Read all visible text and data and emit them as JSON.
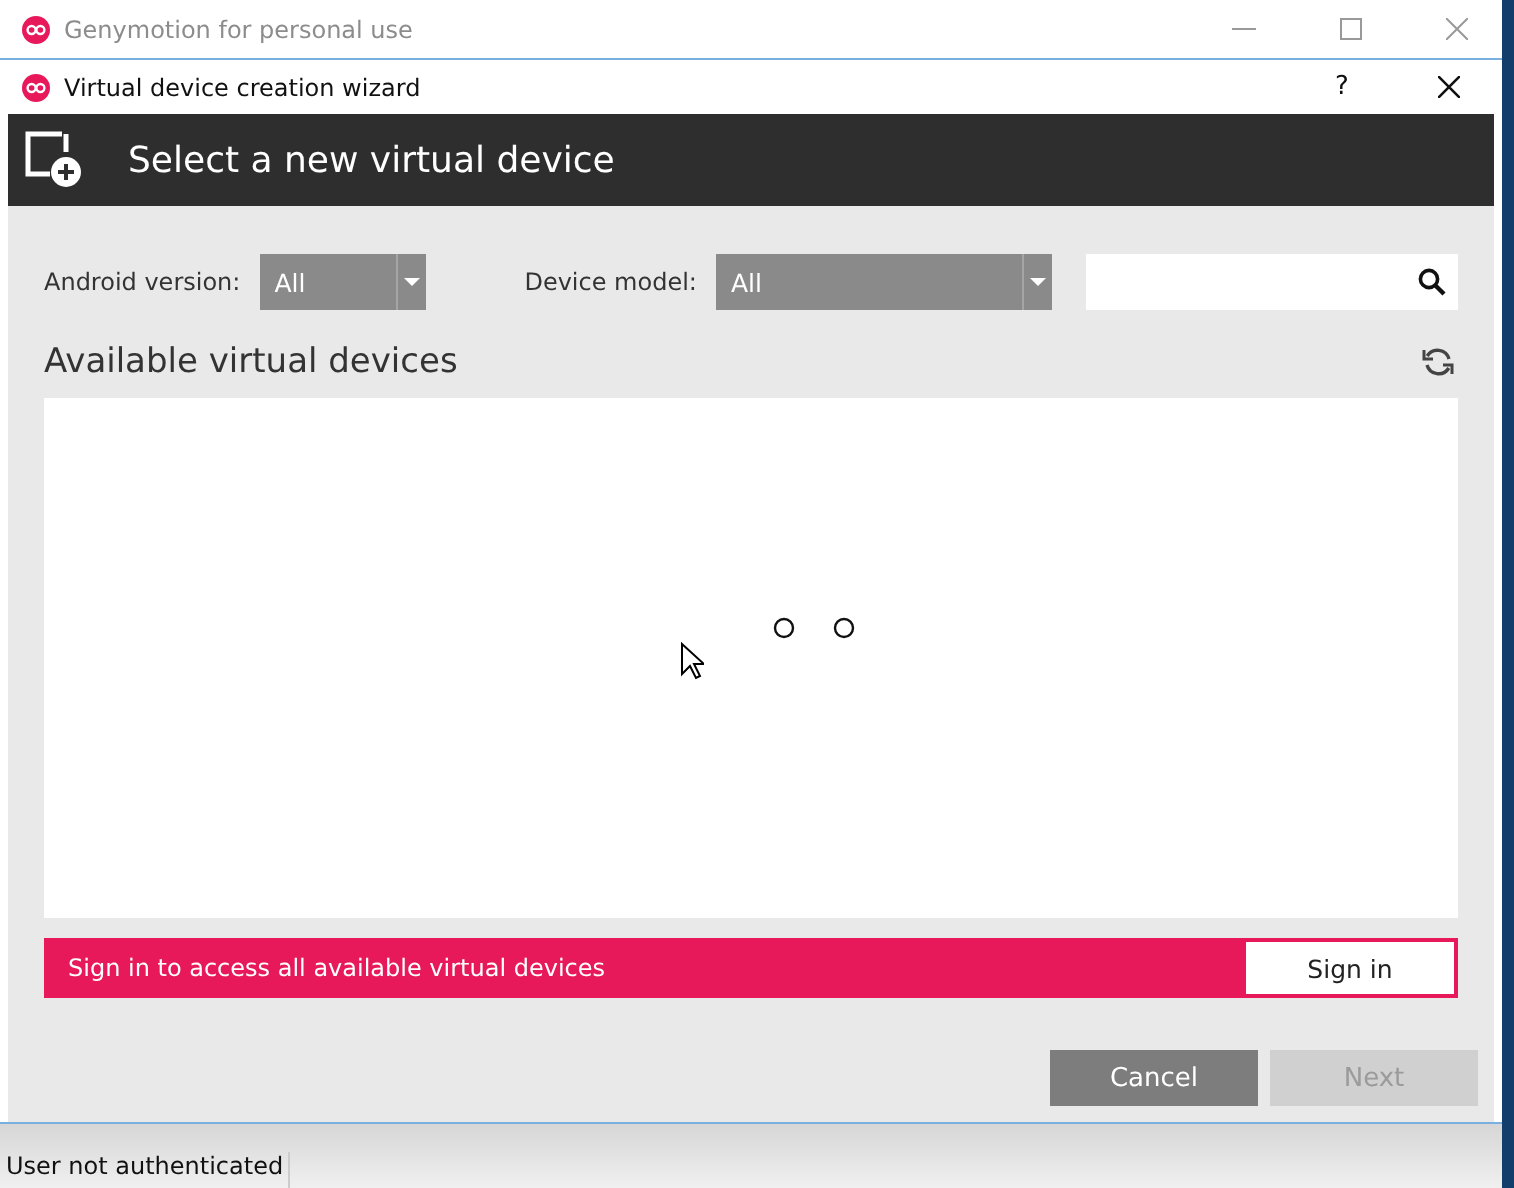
{
  "main_window": {
    "title": "Genymotion for personal use"
  },
  "dialog": {
    "title": "Virtual device creation wizard",
    "help": "?",
    "header": "Select a new virtual device"
  },
  "filters": [
    {
      "label": "Android version:",
      "value": "All"
    },
    {
      "label": "Device model:",
      "value": "All"
    }
  ],
  "device_list": {
    "title": "Available virtual devices",
    "loading": true
  },
  "banner": {
    "message": "Sign in to access all available virtual devices",
    "button": "Sign in"
  },
  "buttons": [
    {
      "label": "Cancel",
      "disabled": false
    },
    {
      "label": "Next",
      "disabled": true
    }
  ],
  "status_bar": "User not authenticated"
}
